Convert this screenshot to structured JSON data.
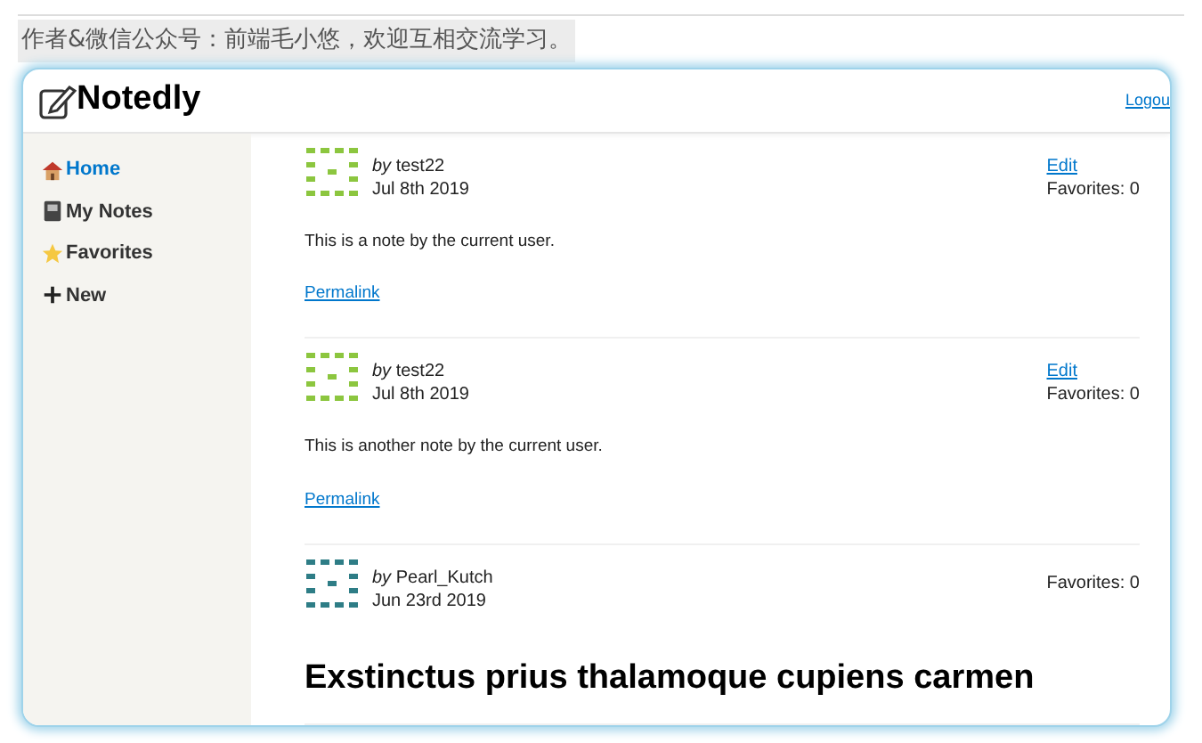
{
  "caption": "作者&微信公众号：前端毛小悠，欢迎互相交流学习。",
  "header": {
    "title": "Notedly",
    "logout": "Logou"
  },
  "sidebar": {
    "items": [
      {
        "label": "Home",
        "kind": "house",
        "selected": true
      },
      {
        "label": "My Notes",
        "kind": "notebook",
        "selected": false
      },
      {
        "label": "Favorites",
        "kind": "star",
        "selected": false
      },
      {
        "label": "New",
        "kind": "plus",
        "selected": false
      }
    ]
  },
  "notes": [
    {
      "by": "by",
      "author": "test22",
      "date": "Jul 8th 2019",
      "color": "#8cc63f",
      "edit": "Edit",
      "favorites": "Favorites: 0",
      "content": [
        {
          "kind": "paragraph",
          "text": "This is a note by the current user."
        }
      ],
      "permalink": "Permalink"
    },
    {
      "by": "by",
      "author": "test22",
      "date": "Jul 8th 2019",
      "color": "#8cc63f",
      "edit": "Edit",
      "favorites": "Favorites: 0",
      "content": [
        {
          "kind": "paragraph",
          "text": "This is another note by the current user."
        }
      ],
      "permalink": "Permalink"
    },
    {
      "by": "by",
      "author": "Pearl_Kutch",
      "date": "Jun 23rd 2019",
      "color": "#2e7d86",
      "favorites": "Favorites: 0",
      "content": [
        {
          "kind": "heading",
          "text": "Exstinctus prius thalamoque cupiens carmen"
        }
      ]
    }
  ]
}
